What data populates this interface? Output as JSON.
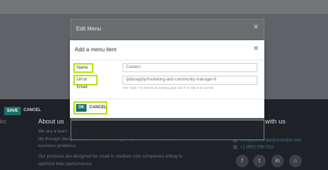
{
  "background": {
    "left_label": "ks",
    "about_title": "About us",
    "about_lines": [
      "We are a team",
      "life through disruptive products. We build great products to solve your",
      "business problems.",
      "Our products are designed for small to medium size companies willing to",
      "optimize their performance."
    ],
    "connect_title": "with us",
    "contact_email": "info@yourcompany.example.com",
    "contact_phone": "+1 (650) 555-0111",
    "social_icons": [
      "f",
      "t",
      "in",
      "⌂"
    ]
  },
  "edit_menu": {
    "title": "Edit Menu",
    "save_label": "SAVE",
    "cancel_label": "CANCEL"
  },
  "dialog": {
    "title": "Add a menu item",
    "name_label": "Name",
    "name_value": "Careers",
    "url_label": "Url or Email",
    "url_value": "/jobs/apply/marketing-and-community-manager-6",
    "hint": "Hint: Type '/' to search an existing page and '#' to link to an anchor.",
    "ok_label": "OK",
    "cancel_label": "CANCEL"
  },
  "colors": {
    "highlight": "#b4e400",
    "primary": "#1f6f6b"
  }
}
